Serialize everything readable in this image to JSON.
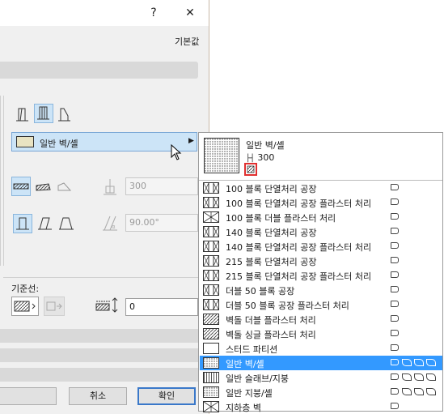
{
  "dialog": {
    "help_glyph": "?",
    "close_glyph": "✕",
    "default_label": "기본값",
    "composite_selected": "일반 벽/셸",
    "dim_value": "300",
    "angle_value": "90.00°",
    "ref_line_label": "기준선:",
    "offset_value": "0",
    "cancel_label": "취소",
    "ok_label": "확인"
  },
  "popup": {
    "header_name": "일반 벽/셸",
    "header_thickness": "300",
    "items": [
      {
        "label": "100 블록 단열처리 공장",
        "pattern": "block",
        "selected": false,
        "extra_icons": 0
      },
      {
        "label": "100 블록 단열처리 공장 플라스터 처리",
        "pattern": "block",
        "selected": false,
        "extra_icons": 0
      },
      {
        "label": "100 블록 더블 플라스터 처리",
        "pattern": "cross",
        "selected": false,
        "extra_icons": 0
      },
      {
        "label": "140 블록 단열처리 공장",
        "pattern": "block",
        "selected": false,
        "extra_icons": 0
      },
      {
        "label": "140 블록 단열처리 공장 플라스터 처리",
        "pattern": "block",
        "selected": false,
        "extra_icons": 0
      },
      {
        "label": "215 블록 단열처리 공장",
        "pattern": "block",
        "selected": false,
        "extra_icons": 0
      },
      {
        "label": "215 블록 단열처리 공장 플라스터 처리",
        "pattern": "block",
        "selected": false,
        "extra_icons": 0
      },
      {
        "label": "더블 50 블록 공장",
        "pattern": "block",
        "selected": false,
        "extra_icons": 0
      },
      {
        "label": "더블 50 블록 공장 플라스터 처리",
        "pattern": "block",
        "selected": false,
        "extra_icons": 0
      },
      {
        "label": "벽돌 더블 플라스터 처리",
        "pattern": "hatch",
        "selected": false,
        "extra_icons": 0
      },
      {
        "label": "벽돌 싱글 플라스터 처리",
        "pattern": "hatch",
        "selected": false,
        "extra_icons": 0
      },
      {
        "label": "스터드 파티션",
        "pattern": "plain",
        "selected": false,
        "extra_icons": 0
      },
      {
        "label": "일반 벽/셸",
        "pattern": "dots",
        "selected": true,
        "extra_icons": 3
      },
      {
        "label": "일반 슬래브/지붕",
        "pattern": "stripe",
        "selected": false,
        "extra_icons": 3
      },
      {
        "label": "일반 지붕/셸",
        "pattern": "dots",
        "selected": false,
        "extra_icons": 3
      },
      {
        "label": "지하층 벽",
        "pattern": "cross",
        "selected": false,
        "extra_icons": 0
      }
    ]
  }
}
